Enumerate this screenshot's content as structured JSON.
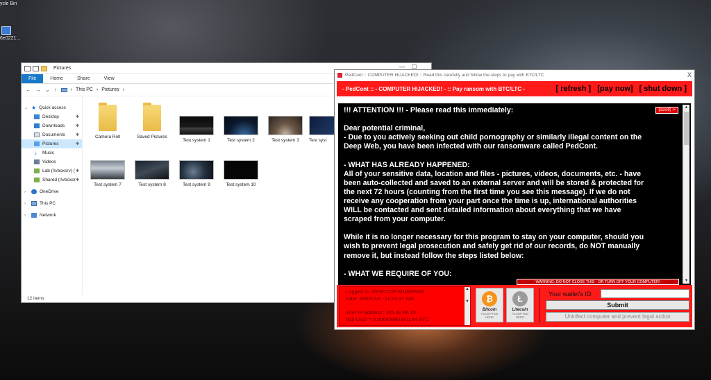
{
  "desktop": {
    "icons": [
      {
        "label": "ycle Bin"
      },
      {
        "label": "6e0221..."
      }
    ]
  },
  "explorer": {
    "title": "Pictures",
    "ribbon_tabs": [
      "File",
      "Home",
      "Share",
      "View"
    ],
    "breadcrumb": [
      "This PC",
      "Pictures"
    ],
    "nav": {
      "quick_access": "Quick access",
      "items": [
        "Desktop",
        "Downloads",
        "Documents",
        "Pictures",
        "Music",
        "Videos",
        "Lab (\\\\vboxsrv) (",
        "Shared (\\\\vboxsr"
      ],
      "onedrive": "OneDrive",
      "this_pc": "This PC",
      "network": "Network"
    },
    "files": [
      {
        "name": "Camera Roll",
        "kind": "folder"
      },
      {
        "name": "Saved Pictures",
        "kind": "folder"
      },
      {
        "name": "Test system 1",
        "kind": "image"
      },
      {
        "name": "Test system 2",
        "kind": "image"
      },
      {
        "name": "Test system 3",
        "kind": "image"
      },
      {
        "name": "Test syst",
        "kind": "image"
      },
      {
        "name": "Test system 7",
        "kind": "image"
      },
      {
        "name": "Test system 8",
        "kind": "image"
      },
      {
        "name": "Test system 9",
        "kind": "image"
      },
      {
        "name": "Test system 10",
        "kind": "image"
      }
    ],
    "status": "12 items"
  },
  "ransom": {
    "title": "PedCont :: COMPUTER HIJACKED! :: Read this carefully and follow the steps to pay with BTC/LTC",
    "close": "X",
    "header": "- PedCont :: - COMPUTER HIJACKED! - :: Pay ransom with BTC/LTC -",
    "actions": {
      "refresh": "[ refresh ]",
      "pay": "[pay now]",
      "shutdown": "[ shut down ]"
    },
    "scroll_button": "[scroll] ->",
    "message": "!!! ATTENTION !!! - Please read this immediately:\n\nDear potential criminal,\n- Due to you actively seeking out child pornography or similarly illegal content on the\nDeep Web, you have been infected with our ransomware called PedCont.\n\n- WHAT HAS ALREADY HAPPENED:\nAll of your sensitive data, location and files - pictures, videos, documents, etc. - have\nbeen auto-collected and saved to an external server and will be stored & protected for\nthe next 72 hours (counting from the first time you see this message). If we do not\nreceive any cooperation from your part once the time is up, international authorities\nWILL be contacted and sent detailed information about everything that we have\nscraped from your computer.\n\nWhile it is no longer necessary for this program to stay on your computer, should you\nwish to prevent legal prosecution and safely get rid of our records, do NOT manually\nremove it, but instead follow the steps listed below:\n\n- WHAT WE REQUIRE OF YOU:",
    "warning": "- WARNING: DO NOT CLOSE THIS - OR TURN OFF YOUR COMPUTER! -",
    "info": {
      "logged_in": "Logged in: DESKTOP-MMK6PKM",
      "date": "Date: 6/4/2018 - 11:23:37 AM",
      "ip": "Your IP address: 105.92.46.10",
      "usd": "50$ USD = 0.00649990341144 BTC"
    },
    "coins": [
      {
        "name": "Bitcoin",
        "symbol": "₿",
        "accepted": "ACCEPTED HERE",
        "color": "#f7931a"
      },
      {
        "name": "Litecoin",
        "symbol": "Ł",
        "accepted": "ACCEPTED HERE",
        "color": "#9a9a9a"
      }
    ],
    "wallet_label": "Your wallet's ID:",
    "wallet_value": "",
    "submit": "Submit",
    "uninfect": "Uninfect computer and prevent legal action"
  },
  "colors": {
    "ransom_red": "#ff1a1a",
    "explorer_accent": "#1979ca"
  }
}
